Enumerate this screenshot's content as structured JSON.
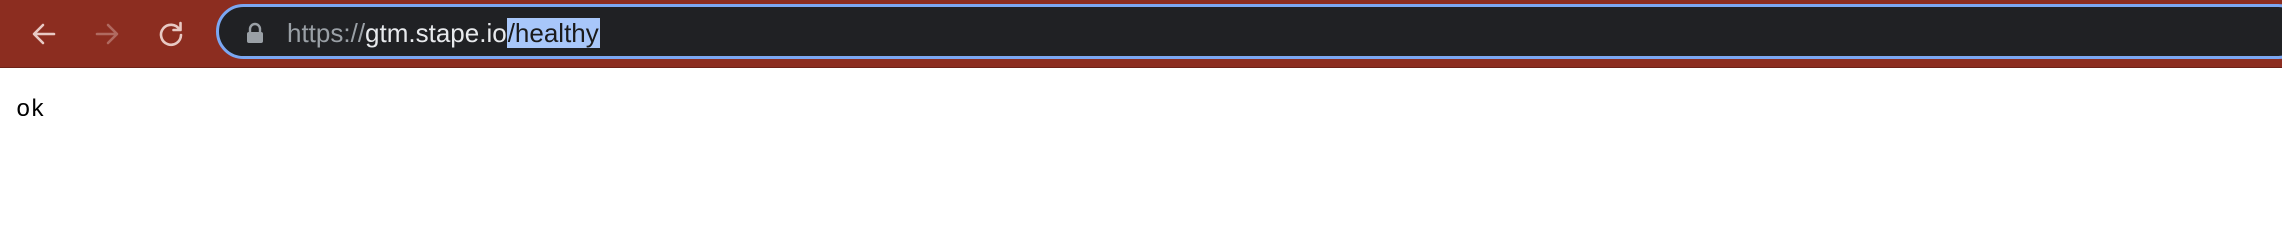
{
  "browser": {
    "back_icon": "arrow-left-icon",
    "forward_icon": "arrow-right-icon",
    "reload_icon": "reload-icon",
    "lock_icon": "lock-icon",
    "toolbar_color": "#8c2d20",
    "omnibox_color": "#202124",
    "focus_ring_color": "#7ba7f2",
    "selection_color": "#a8c7fa",
    "address": {
      "scheme": "https://",
      "host": "gtm.stape.io",
      "path": "/healthy"
    }
  },
  "page": {
    "body_text": "ok"
  }
}
